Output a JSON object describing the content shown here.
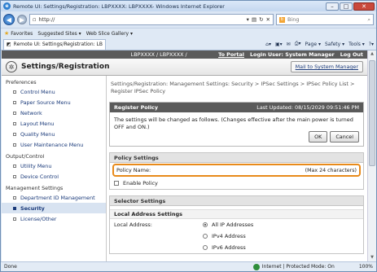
{
  "window": {
    "title": "Remote UI: Settings/Registration: LBPXXXX: LBPXXXX- Windows Internet Explorer"
  },
  "nav": {
    "address": "http://",
    "search_placeholder": "Bing"
  },
  "favorites": {
    "label": "Favorites",
    "suggested": "Suggested Sites ▾",
    "gallery": "Web Slice Gallery ▾"
  },
  "tab": {
    "label": "Remote UI: Settings/Registration: LBPXXXX: LBPX..."
  },
  "commands": {
    "page": "Page ▾",
    "safety": "Safety ▾",
    "tools": "Tools ▾"
  },
  "header": {
    "device": "LBPXXXX / LBPXXXX /",
    "to_portal": "To Portal",
    "login_user": "Login User: System Manager",
    "logout": "Log Out"
  },
  "page": {
    "title": "Settings/Registration",
    "mail_button": "Mail to System Manager"
  },
  "sidebar": {
    "cat_preferences": "Preferences",
    "control_menu": "Control Menu",
    "paper_source": "Paper Source Menu",
    "network": "Network",
    "layout": "Layout Menu",
    "quality": "Quality Menu",
    "user_maint": "User Maintenance Menu",
    "cat_output": "Output/Control",
    "utility": "Utility Menu",
    "device_control": "Device Control",
    "cat_management": "Management Settings",
    "dept_id": "Department ID Management",
    "security": "Security",
    "license": "License/Other"
  },
  "breadcrumb": "Settings/Registration: Management Settings: Security > IPSec Settings > IPSec Policy List > Register IPSec Policy",
  "register": {
    "title": "Register Policy",
    "last_updated": "Last Updated: 08/15/2029 09:51:46 PM",
    "message": "The settings will be changed as follows. (Changes effective after the main power is turned OFF and ON.)",
    "ok": "OK",
    "cancel": "Cancel"
  },
  "policy": {
    "section": "Policy Settings",
    "name_label": "Policy Name:",
    "name_hint": "(Max 24 characters)",
    "enable_label": "Enable Policy"
  },
  "selector": {
    "section": "Selector Settings",
    "local_section": "Local Address Settings",
    "local_label": "Local Address:",
    "opt_all": "All IP Addresses",
    "opt_ipv4": "IPv4 Address",
    "opt_ipv6": "IPv6 Address"
  },
  "status": {
    "left": "Done",
    "zone": "Internet | Protected Mode: On",
    "zoom": "100%"
  }
}
